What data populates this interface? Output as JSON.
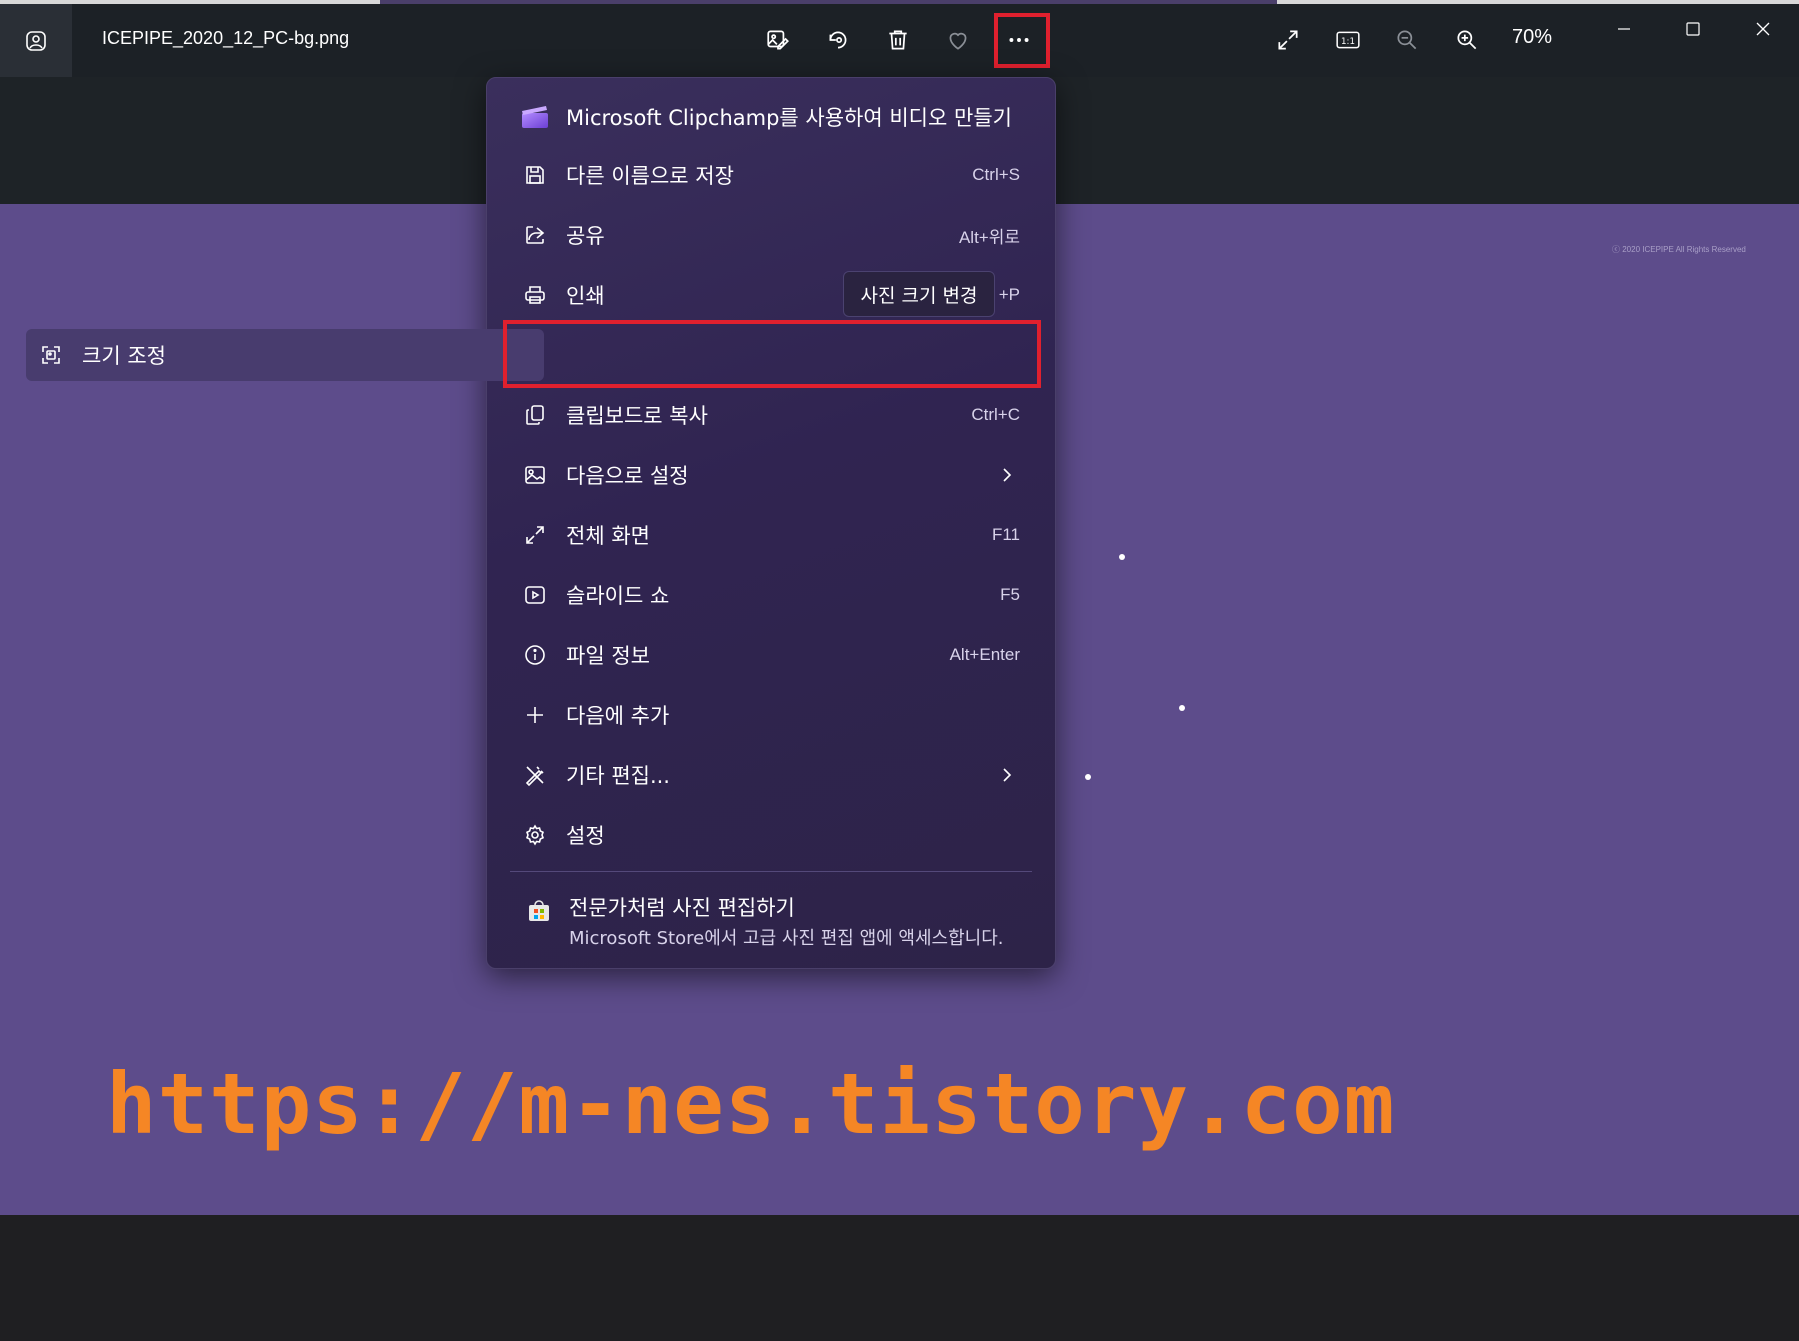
{
  "window": {
    "filename": "ICEPIPE_2020_12_PC-bg.png",
    "zoom_label": "70%"
  },
  "toolbar": {
    "icons": [
      "edit-image-icon",
      "rotate-icon",
      "delete-icon",
      "favorite-icon",
      "more-options-icon",
      "fullscreen-icon",
      "actual-size-icon",
      "zoom-out-icon",
      "zoom-in-icon"
    ]
  },
  "photo": {
    "copyright": "ⓒ 2020 ICEPIPE All Rights Reserved",
    "watermark": "https://m-nes.tistory.com"
  },
  "menu": {
    "items": [
      {
        "label": "Microsoft Clipchamp를 사용하여 비디오 만들기",
        "shortcut": "",
        "icon": "clipchamp-icon"
      },
      {
        "label": "다른 이름으로 저장",
        "shortcut": "Ctrl+S",
        "icon": "save-icon"
      },
      {
        "label": "공유",
        "shortcut": "Alt+위로",
        "icon": "share-icon"
      },
      {
        "label": "인쇄",
        "shortcut": "+P",
        "icon": "print-icon"
      },
      {
        "label": "크기 조정",
        "shortcut": "",
        "icon": "resize-icon"
      },
      {
        "label": "클립보드로 복사",
        "shortcut": "Ctrl+C",
        "icon": "copy-icon"
      },
      {
        "label": "다음으로 설정",
        "shortcut": "",
        "icon": "set-as-icon"
      },
      {
        "label": "전체 화면",
        "shortcut": "F11",
        "icon": "fullscreen-icon"
      },
      {
        "label": "슬라이드 쇼",
        "shortcut": "F5",
        "icon": "slideshow-icon"
      },
      {
        "label": "파일 정보",
        "shortcut": "Alt+Enter",
        "icon": "info-icon"
      },
      {
        "label": "다음에 추가",
        "shortcut": "",
        "icon": "add-icon"
      },
      {
        "label": "기타 편집...",
        "shortcut": "",
        "icon": "other-edits-icon"
      },
      {
        "label": "설정",
        "shortcut": "",
        "icon": "settings-icon"
      }
    ],
    "tooltip": "사진 크기 변경",
    "store": {
      "title": "전문가처럼 사진 편집하기",
      "subtitle": "Microsoft Store에서 고급 사진 편집 앱에 액세스합니다."
    }
  },
  "colors": {
    "photo_bg": "#5d4c8b",
    "menu_bg": "#302451",
    "highlight": "#e0202e",
    "watermark": "#f58625"
  }
}
